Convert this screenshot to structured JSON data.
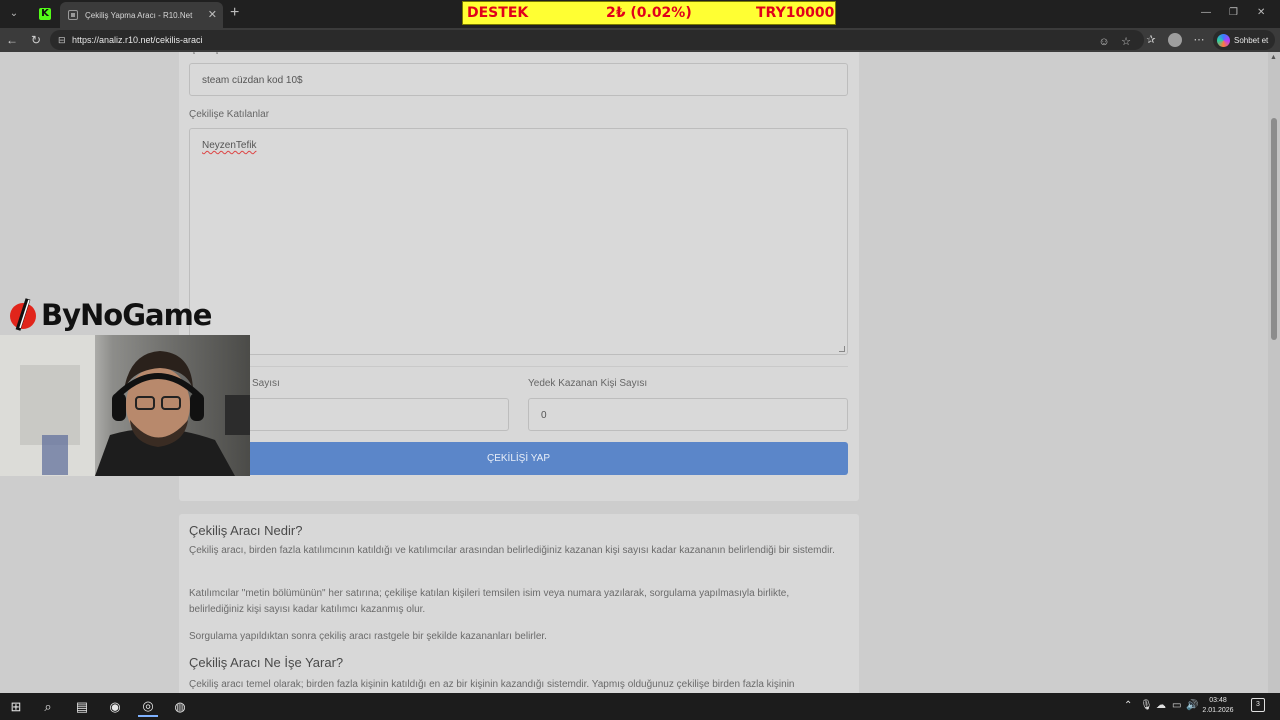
{
  "browser": {
    "active_tab_title": "Çekiliş Yapma Aracı - R10.Net",
    "url": "https://analiz.r10.net/cekilis-araci",
    "copilot_label": "Sohbet et"
  },
  "ticker": {
    "left": "DESTEK",
    "middle": "2₺ (0.02%)",
    "right": "TRY10000"
  },
  "form": {
    "prize_value": "steam cüzdan kod 10$",
    "participants_label": "Çekilişe Katılanlar",
    "participants_value": "NeyzenTefik",
    "winner_count_label_partial": "Sayısı",
    "backup_winner_label": "Yedek Kazanan Kişi Sayısı",
    "backup_winner_value": "0",
    "submit_label": "ÇEKİLİŞİ YAP"
  },
  "info": {
    "heading1": "Çekiliş Aracı Nedir?",
    "p1": "Çekiliş aracı, birden fazla katılımcının katıldığı ve katılımcılar arasından belirlediğiniz kazanan kişi sayısı kadar kazananın belirlendiği bir sistemdir.",
    "p2": "Katılımcılar \"metin bölümünün\" her satırına; çekilişe katılan kişileri temsilen isim veya numara yazılarak, sorgulama yapılmasıyla birlikte, belirlediğiniz kişi sayısı kadar katılımcı kazanmış olur.",
    "p3": "Sorgulama yapıldıktan sonra çekiliş aracı rastgele bir şekilde kazananları belirler.",
    "heading2": "Çekiliş Aracı Ne İşe Yarar?",
    "p4": "Çekiliş aracı temel olarak; birden fazla kişinin katıldığı en az bir kişinin kazandığı sistemdir. Yapmış olduğunuz çekilişe birden fazla kişinin"
  },
  "overlay": {
    "brand": "ByNoGame"
  },
  "taskbar": {
    "time": "03:48",
    "date": "2.01.2026",
    "notification_count": "3"
  },
  "colors": {
    "ticker_bg": "#ffff33",
    "ticker_text": "#e0001b",
    "submit_button": "#5b86c9",
    "kick_green": "#53fc18"
  }
}
